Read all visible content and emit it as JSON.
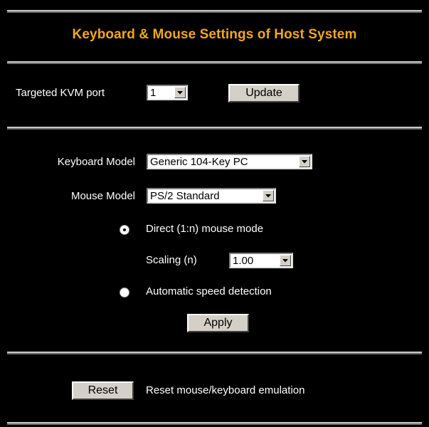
{
  "header": {
    "title": "Keyboard & Mouse Settings of Host System"
  },
  "port": {
    "label": "Targeted KVM port",
    "value": "1",
    "update_label": "Update"
  },
  "settings": {
    "keyboard_label": "Keyboard Model",
    "keyboard_value": "Generic 104-Key PC",
    "mouse_label": "Mouse Model",
    "mouse_value": "PS/2 Standard",
    "direct_mode_label": "Direct (1:n) mouse mode",
    "direct_mode_selected": true,
    "scaling_label": "Scaling (n)",
    "scaling_value": "1.00",
    "auto_speed_label": "Automatic speed detection",
    "auto_speed_selected": false,
    "apply_label": "Apply"
  },
  "reset": {
    "button_label": "Reset",
    "description": "Reset mouse/keyboard emulation"
  },
  "colors": {
    "background": "#000000",
    "title": "#f0a81e",
    "text": "#ffffff",
    "button_face": "#d4d0c8"
  }
}
